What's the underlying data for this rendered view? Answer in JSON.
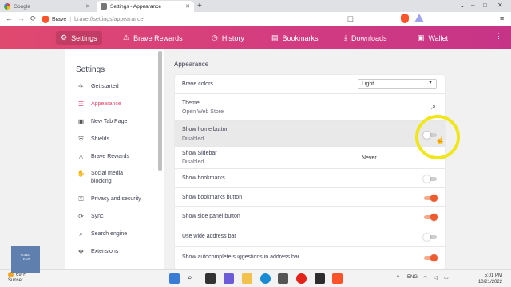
{
  "tabs": [
    {
      "title": "Google",
      "active": false
    },
    {
      "title": "Settings - Appearance",
      "active": true
    }
  ],
  "window_controls": {
    "minimize": "–",
    "maximize": "□",
    "close": "✕",
    "chevron": "⌄"
  },
  "address_bar": {
    "site_name": "Brave",
    "url": "brave://settings/appearance"
  },
  "settings_nav": [
    {
      "label": "Settings",
      "icon": "gear-icon",
      "glyph": "⚙",
      "active": true
    },
    {
      "label": "Brave Rewards",
      "icon": "rewards-icon",
      "glyph": "⚠",
      "active": false
    },
    {
      "label": "History",
      "icon": "history-icon",
      "glyph": "◷",
      "active": false
    },
    {
      "label": "Bookmarks",
      "icon": "bookmarks-icon",
      "glyph": "▤",
      "active": false
    },
    {
      "label": "Downloads",
      "icon": "downloads-icon",
      "glyph": "⤓",
      "active": false
    },
    {
      "label": "Wallet",
      "icon": "wallet-icon",
      "glyph": "▣",
      "active": false
    }
  ],
  "sidebar": {
    "heading": "Settings",
    "items": [
      {
        "label": "Get started",
        "icon": "rocket-icon",
        "glyph": "✈",
        "active": false
      },
      {
        "label": "Appearance",
        "icon": "appearance-icon",
        "glyph": "☰",
        "active": true
      },
      {
        "label": "New Tab Page",
        "icon": "new-tab-icon",
        "glyph": "▣",
        "active": false
      },
      {
        "label": "Shields",
        "icon": "shield-icon",
        "glyph": "⛨",
        "active": false
      },
      {
        "label": "Brave Rewards",
        "icon": "rewards-icon",
        "glyph": "△",
        "active": false
      },
      {
        "label": "Social media blocking",
        "icon": "thumbs-down-icon",
        "glyph": "✋",
        "active": false
      },
      {
        "label": "Privacy and security",
        "icon": "privacy-icon",
        "glyph": "⚿",
        "active": false
      },
      {
        "label": "Sync",
        "icon": "sync-icon",
        "glyph": "⟳",
        "active": false
      },
      {
        "label": "Search engine",
        "icon": "search-icon",
        "glyph": "⌕",
        "active": false
      },
      {
        "label": "Extensions",
        "icon": "extensions-icon",
        "glyph": "✥",
        "active": false
      }
    ]
  },
  "main": {
    "section_title": "Appearance",
    "rows": [
      {
        "title": "Brave colors",
        "control": "select",
        "value": "Light"
      },
      {
        "title": "Theme",
        "subtitle": "Open Web Store",
        "control": "link"
      },
      {
        "title": "Show home button",
        "subtitle": "Disabled",
        "control": "toggle",
        "on": false
      },
      {
        "title": "Show Sidebar",
        "subtitle": "Disabled",
        "control": "select-flat",
        "value": "Never"
      },
      {
        "title": "Show bookmarks",
        "control": "toggle",
        "on": false
      },
      {
        "title": "Show bookmarks button",
        "control": "toggle",
        "on": true
      },
      {
        "title": "Show side panel button",
        "control": "toggle",
        "on": true
      },
      {
        "title": "Use wide address bar",
        "control": "toggle",
        "on": false
      },
      {
        "title": "Show autocomplete suggestions in address bar",
        "control": "toggle",
        "on": true
      }
    ]
  },
  "taskbar": {
    "weather_temp": "69°F",
    "weather_desc": "Sunset",
    "language": "ENG",
    "time": "5:01 PM",
    "date": "10/21/2022"
  },
  "watermark": {
    "line1": "SONIC",
    "line2": "TECH"
  },
  "colors": {
    "accent": "#e0496f",
    "toggle_on": "#f15a2c",
    "highlight_ring": "#f0e61a"
  }
}
